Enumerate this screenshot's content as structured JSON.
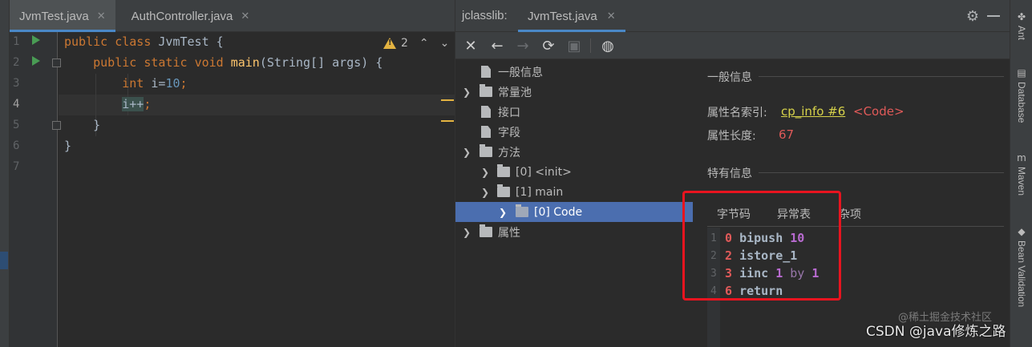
{
  "editor": {
    "tabs": [
      {
        "label": "JvmTest.java",
        "active": true
      },
      {
        "label": "AuthController.java",
        "active": false
      }
    ],
    "line_numbers": [
      "1",
      "2",
      "3",
      "4",
      "5",
      "6",
      "7"
    ],
    "current_line": "4",
    "code": {
      "l1": {
        "kw1": "public",
        "kw2": "class",
        "rest": " JvmTest {"
      },
      "l2": {
        "kw1": "public",
        "kw2": "static",
        "kw3": "void",
        "fn": "main",
        "rest": "(String[] args) {"
      },
      "l3": {
        "kw": "int",
        "mid": " i=",
        "num": "10",
        "end": ";"
      },
      "l4": {
        "sel": "i++",
        "end": ";"
      },
      "l5": "}",
      "l6": "}"
    },
    "problems_count": "2"
  },
  "panel": {
    "title": "jclasslib:",
    "tab": "JvmTest.java",
    "toolbar_icons": [
      "close-icon",
      "back-icon",
      "forward-icon",
      "refresh-icon",
      "save-icon",
      "browser-icon"
    ],
    "tree": {
      "general": "一般信息",
      "constant_pool": "常量池",
      "interfaces": "接口",
      "fields": "字段",
      "methods": "方法",
      "method_init": "[0] <init>",
      "method_main": "[1] main",
      "code": "[0] Code",
      "attributes": "属性"
    },
    "info": {
      "general_heading": "一般信息",
      "name_index_label": "属性名索引:",
      "name_index_link": "cp_info #6",
      "name_index_value": "<Code>",
      "length_label": "属性长度:",
      "length_value": "67",
      "specific_heading": "特有信息",
      "subtabs": [
        "字节码",
        "异常表",
        "杂项"
      ],
      "bytecode": [
        {
          "ln": "1",
          "offset": "0",
          "op": "bipush",
          "arg": "10"
        },
        {
          "ln": "2",
          "offset": "2",
          "op": "istore_1"
        },
        {
          "ln": "3",
          "offset": "3",
          "op": "iinc",
          "arg": "1",
          "by": "by",
          "arg2": "1"
        },
        {
          "ln": "4",
          "offset": "6",
          "op": "return"
        }
      ]
    }
  },
  "right_tools": [
    "Ant",
    "Database",
    "Maven",
    "Bean Validation"
  ],
  "watermark": "CSDN @java修炼之路",
  "watermark_faint": "@稀土掘金技术社区",
  "colors": {
    "accent": "#4a88c7",
    "selection": "#4b6eaf",
    "highlight_box": "#e8141f"
  }
}
